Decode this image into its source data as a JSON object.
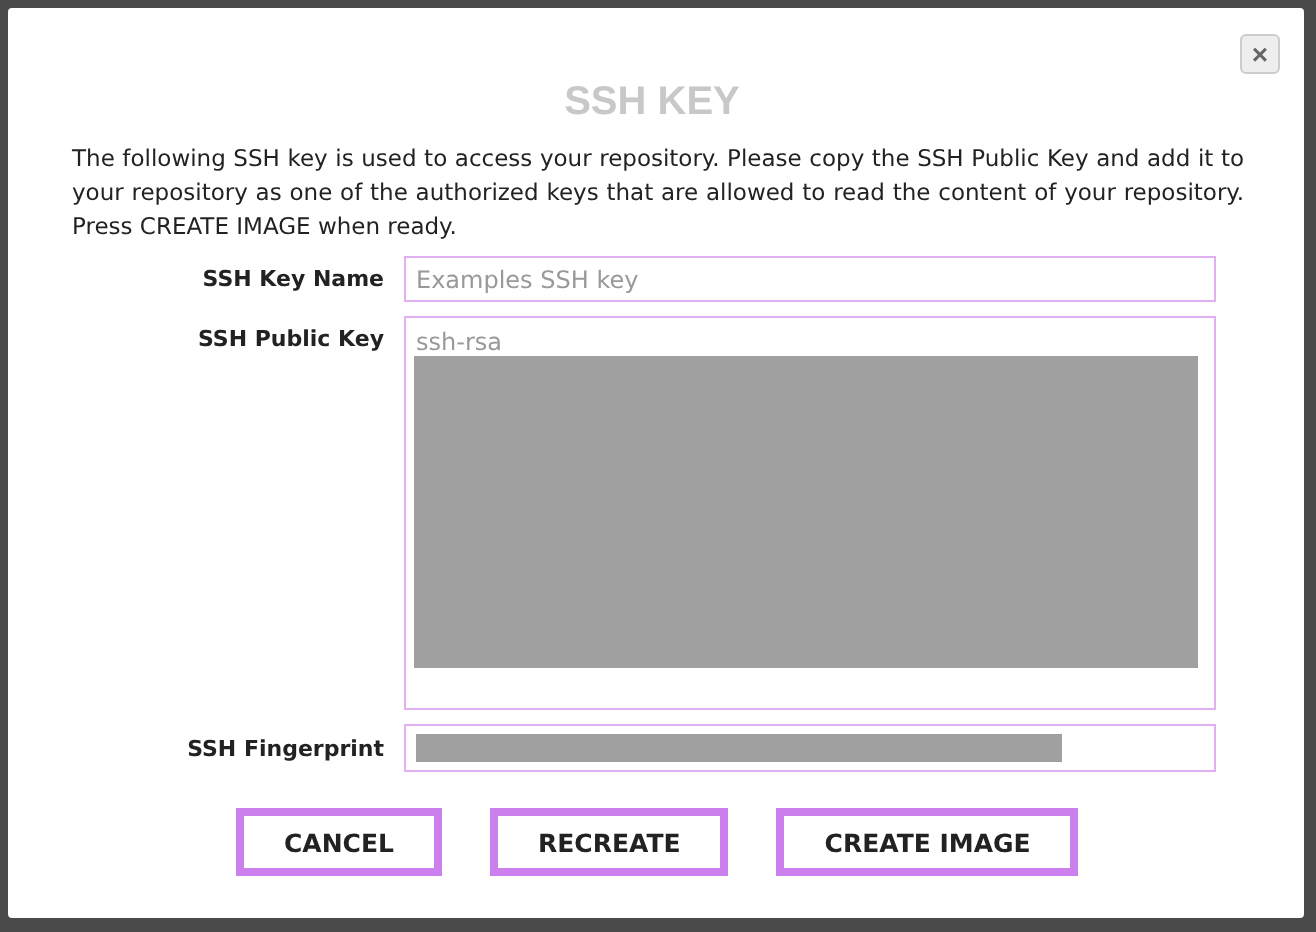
{
  "dialog": {
    "title": "SSH KEY",
    "close_label": "×"
  },
  "description": "The following SSH key is used to access your repository. Please copy the SSH Public Key and add it to your repository as one of the authorized keys that are allowed to read the content of your repository. Press CREATE IMAGE when ready.",
  "fields": [
    {
      "kind": "input",
      "label": "SSH Key Name",
      "placeholder": "Examples SSH key"
    },
    {
      "kind": "textarea",
      "label": "SSH Public Key",
      "value": "ssh-rsa"
    },
    {
      "kind": "redacted",
      "label": "SSH Fingerprint"
    }
  ],
  "buttons": [
    "CANCEL",
    "RECREATE",
    "CREATE IMAGE"
  ]
}
